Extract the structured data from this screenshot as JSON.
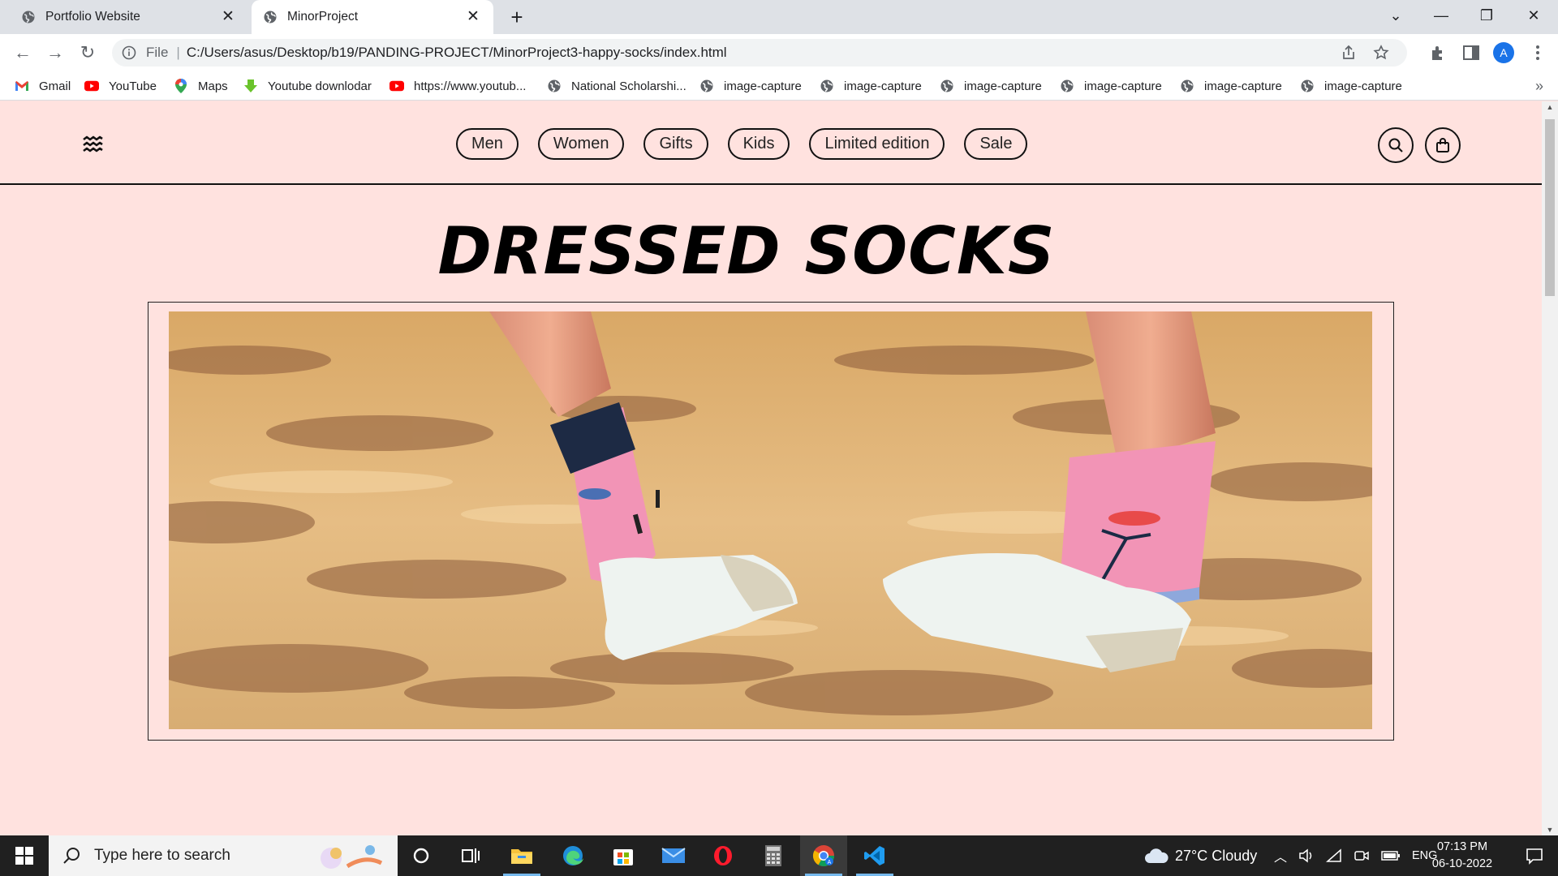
{
  "browser": {
    "tabs": [
      {
        "title": "Portfolio Website",
        "active": false
      },
      {
        "title": "MinorProject",
        "active": true
      }
    ],
    "address": {
      "scheme_label": "File",
      "url": "C:/Users/asus/Desktop/b19/PANDING-PROJECT/MinorProject3-happy-socks/index.html"
    },
    "profile_initial": "A",
    "bookmarks": [
      {
        "label": "Gmail",
        "icon": "gmail-icon"
      },
      {
        "label": "YouTube",
        "icon": "youtube-icon"
      },
      {
        "label": "Maps",
        "icon": "maps-icon"
      },
      {
        "label": "Youtube downlodar",
        "icon": "download-icon"
      },
      {
        "label": "https://www.youtub...",
        "icon": "youtube-icon"
      },
      {
        "label": "National Scholarshi...",
        "icon": "globe-icon"
      },
      {
        "label": "image-capture",
        "icon": "globe-icon"
      },
      {
        "label": "image-capture",
        "icon": "globe-icon"
      },
      {
        "label": "image-capture",
        "icon": "globe-icon"
      },
      {
        "label": "image-capture",
        "icon": "globe-icon"
      },
      {
        "label": "image-capture",
        "icon": "globe-icon"
      },
      {
        "label": "image-capture",
        "icon": "globe-icon"
      }
    ]
  },
  "site": {
    "nav": [
      "Men",
      "Women",
      "Gifts",
      "Kids",
      "Limited edition",
      "Sale"
    ],
    "hero_title": "DRESSED SOCKS",
    "colors": {
      "background": "#ffe2df",
      "text": "#111111"
    }
  },
  "taskbar": {
    "search_placeholder": "Type here to search",
    "weather": "27°C  Cloudy",
    "language": "ENG",
    "time": "07:13 PM",
    "date": "06-10-2022"
  }
}
